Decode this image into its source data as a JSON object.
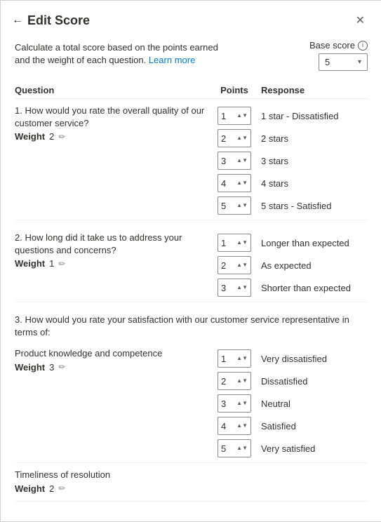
{
  "header": {
    "back_label": "←",
    "title": "Edit Score",
    "close_label": "✕"
  },
  "description": {
    "text": "Calculate a total score based on the points earned and the weight of each question.",
    "learn_more": "Learn more"
  },
  "base_score": {
    "label": "Base score",
    "value": "5",
    "info_icon": "ⓘ"
  },
  "table": {
    "col_question": "Question",
    "col_points": "Points",
    "col_response": "Response"
  },
  "questions": [
    {
      "id": "q1",
      "text": "1. How would you rate the overall quality of our customer service?",
      "weight_label": "Weight",
      "weight_value": "2",
      "responses": [
        {
          "points": "1",
          "response": "1 star - Dissatisfied"
        },
        {
          "points": "2",
          "response": "2 stars"
        },
        {
          "points": "3",
          "response": "3 stars"
        },
        {
          "points": "4",
          "response": "4 stars"
        },
        {
          "points": "5",
          "response": "5 stars - Satisfied"
        }
      ]
    },
    {
      "id": "q2",
      "text": "2. How long did it take us to address your questions and concerns?",
      "weight_label": "Weight",
      "weight_value": "1",
      "responses": [
        {
          "points": "1",
          "response": "Longer than expected"
        },
        {
          "points": "2",
          "response": "As expected"
        },
        {
          "points": "3",
          "response": "Shorter than expected"
        }
      ]
    },
    {
      "id": "q3",
      "text": "3. How would you rate your satisfaction with our customer service representative in terms of:",
      "sub_items": [
        {
          "label": "Product knowledge and competence",
          "weight_label": "Weight",
          "weight_value": "3",
          "responses": [
            {
              "points": "1",
              "response": "Very dissatisfied"
            },
            {
              "points": "2",
              "response": "Dissatisfied"
            },
            {
              "points": "3",
              "response": "Neutral"
            },
            {
              "points": "4",
              "response": "Satisfied"
            },
            {
              "points": "5",
              "response": "Very satisfied"
            }
          ]
        },
        {
          "label": "Timeliness of resolution",
          "weight_label": "Weight",
          "weight_value": "2",
          "responses": []
        }
      ]
    }
  ]
}
